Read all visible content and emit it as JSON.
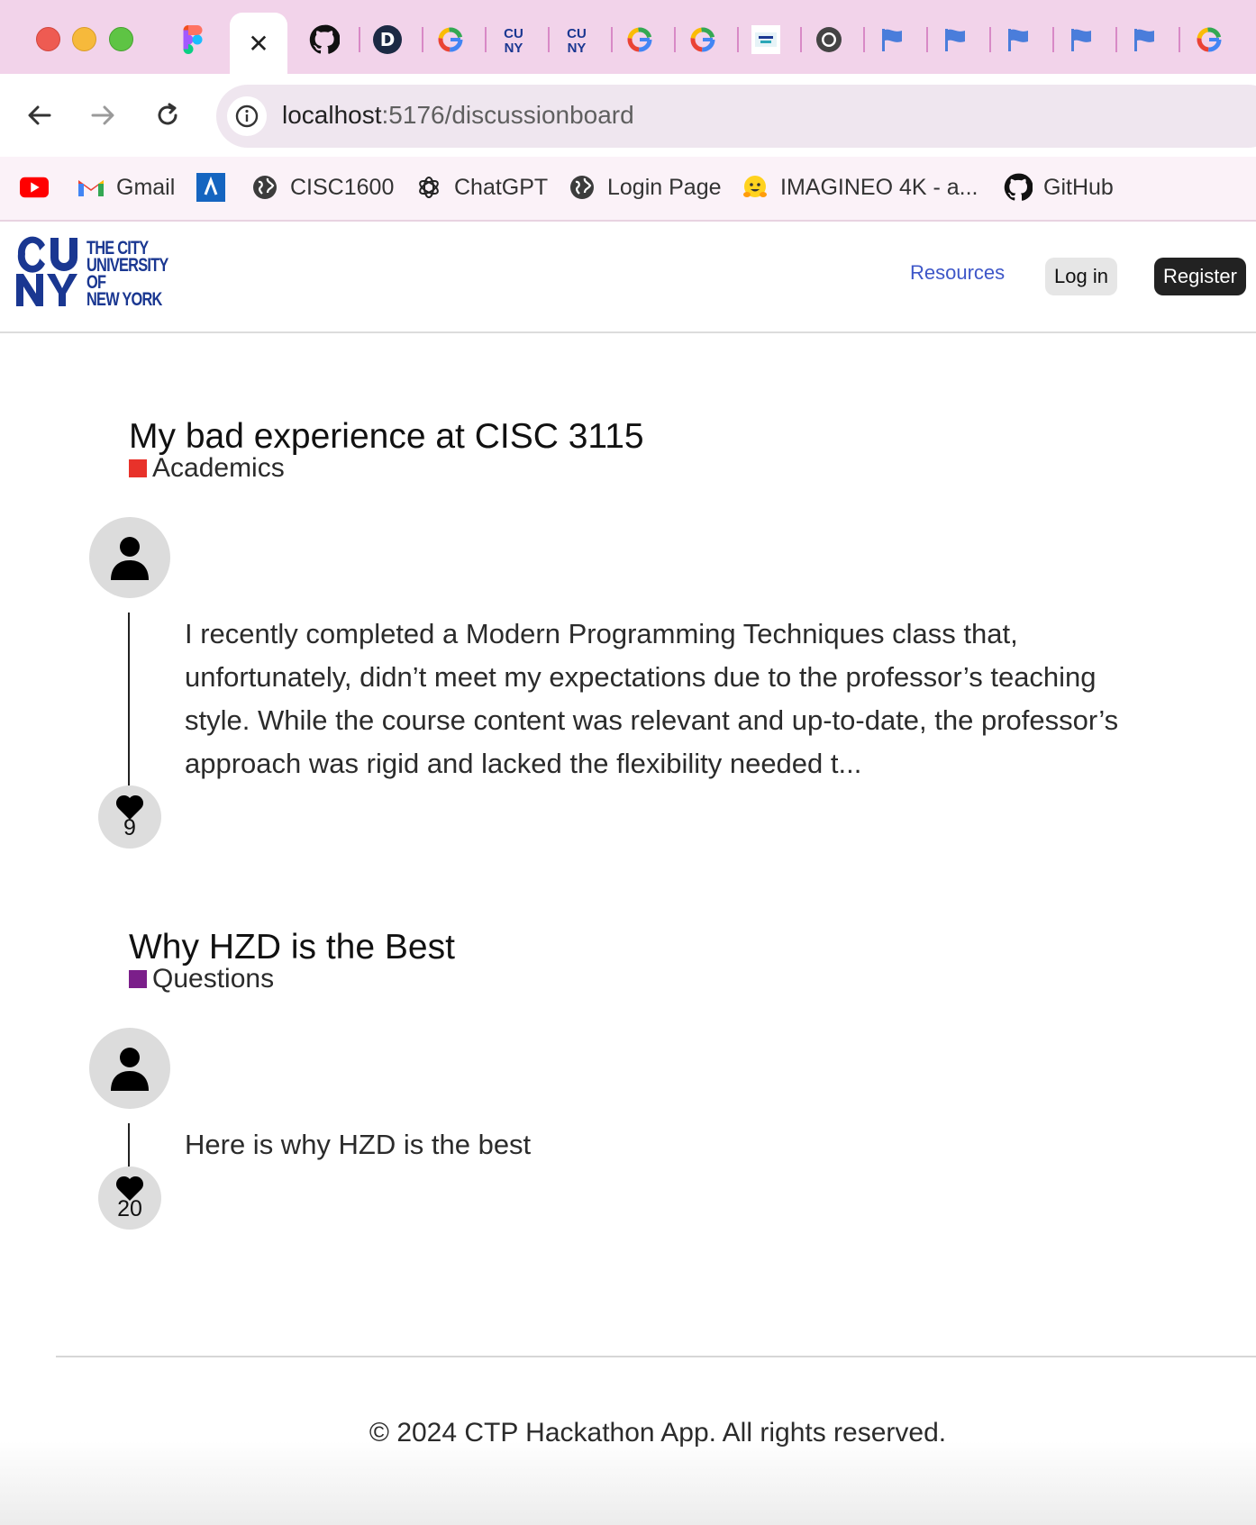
{
  "browser": {
    "tabs": [
      {
        "icon": "figma-icon"
      },
      {
        "icon": "close-icon",
        "active": true
      },
      {
        "icon": "github-icon"
      },
      {
        "icon": "d-logo-icon"
      },
      {
        "icon": "google-icon"
      },
      {
        "icon": "cuny-icon"
      },
      {
        "icon": "cuny-icon"
      },
      {
        "icon": "google-icon"
      },
      {
        "icon": "google-icon"
      },
      {
        "icon": "healthy-cuny-icon"
      },
      {
        "icon": "chrome-icon"
      },
      {
        "icon": "flag-icon"
      },
      {
        "icon": "flag-icon"
      },
      {
        "icon": "flag-icon"
      },
      {
        "icon": "flag-icon"
      },
      {
        "icon": "flag-icon"
      },
      {
        "icon": "google-icon"
      }
    ],
    "url_host": "localhost",
    "url_path": ":5176/discussionboard",
    "bookmarks": [
      {
        "label": "",
        "icon": "youtube-icon"
      },
      {
        "label": "Gmail",
        "icon": "gmail-icon"
      },
      {
        "label": "",
        "icon": "archbee-icon"
      },
      {
        "label": "CISC1600",
        "icon": "globe-icon"
      },
      {
        "label": "ChatGPT",
        "icon": "chatgpt-icon"
      },
      {
        "label": "Login Page",
        "icon": "globe-icon"
      },
      {
        "label": "IMAGINEO 4K - a...",
        "icon": "hugging-face-icon"
      },
      {
        "label": "GitHub",
        "icon": "github-icon"
      }
    ]
  },
  "header": {
    "logo_lines": [
      "THE CITY",
      "UNIVERSITY",
      "OF",
      "NEW YORK"
    ],
    "nav": {
      "resources": "Resources",
      "login": "Log in",
      "register": "Register"
    }
  },
  "posts": [
    {
      "title": "My bad experience at CISC 3115",
      "category": "Academics",
      "category_color": "#e8322a",
      "body": "I recently completed a Modern Programming Techniques class that, unfortunately, didn’t meet my expectations due to the professor’s teaching style. While the course content was relevant and up-to-date, the professor’s approach was rigid and lacked the flexibility needed t...",
      "likes": "9"
    },
    {
      "title": "Why HZD is the Best",
      "category": "Questions",
      "category_color": "#7b1f8a",
      "body": "Here is why HZD is the best",
      "likes": "20"
    }
  ],
  "footer": {
    "text": "© 2024 CTP Hackathon App. All rights reserved."
  },
  "colors": {
    "tabbar": "#f2d3ea",
    "brand_blue": "#1a3791",
    "link_blue": "#3e57c8"
  }
}
